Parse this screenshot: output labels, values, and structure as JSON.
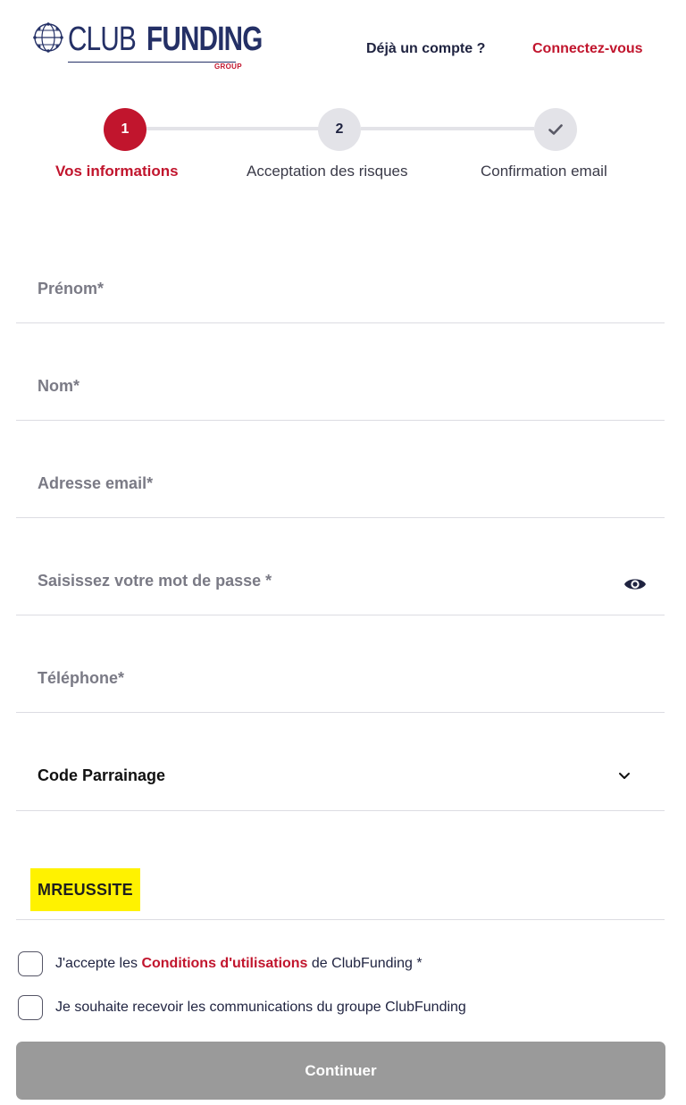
{
  "header": {
    "logo_club": "CLUB",
    "logo_funding": "FUNDING",
    "logo_group": "GROUP",
    "account_question": "Déjà un compte ?",
    "login_link": "Connectez-vous"
  },
  "stepper": {
    "steps": [
      {
        "number": "1",
        "label": "Vos informations",
        "state": "active"
      },
      {
        "number": "2",
        "label": "Acceptation des risques",
        "state": "pending"
      },
      {
        "number": "✔",
        "label": "Confirmation email",
        "state": "pending"
      }
    ]
  },
  "form": {
    "fields": [
      {
        "label": "Prénom*"
      },
      {
        "label": "Nom*"
      },
      {
        "label": "Adresse email*"
      },
      {
        "label": "Saisissez votre mot de passe *"
      },
      {
        "label": "Téléphone*"
      }
    ],
    "referral": {
      "label": "Code Parrainage",
      "value": "MREUSSITE"
    },
    "consents": [
      {
        "prefix": "J'accepte les ",
        "link": "Conditions d'utilisations",
        "suffix": " de ClubFunding *",
        "checked": false
      },
      {
        "text": "Je souhaite recevoir les communications du groupe ClubFunding",
        "checked": false
      }
    ],
    "submit_label": "Continuer"
  },
  "colors": {
    "brand_red": "#c1152d",
    "brand_navy": "#243066",
    "highlight": "#fff200",
    "disabled_button": "#9a9a9a"
  },
  "icons": {
    "logo": "globe-network-icon",
    "password_toggle": "eye-icon",
    "referral_toggle": "chevron-down-icon",
    "step_3": "check-icon"
  }
}
